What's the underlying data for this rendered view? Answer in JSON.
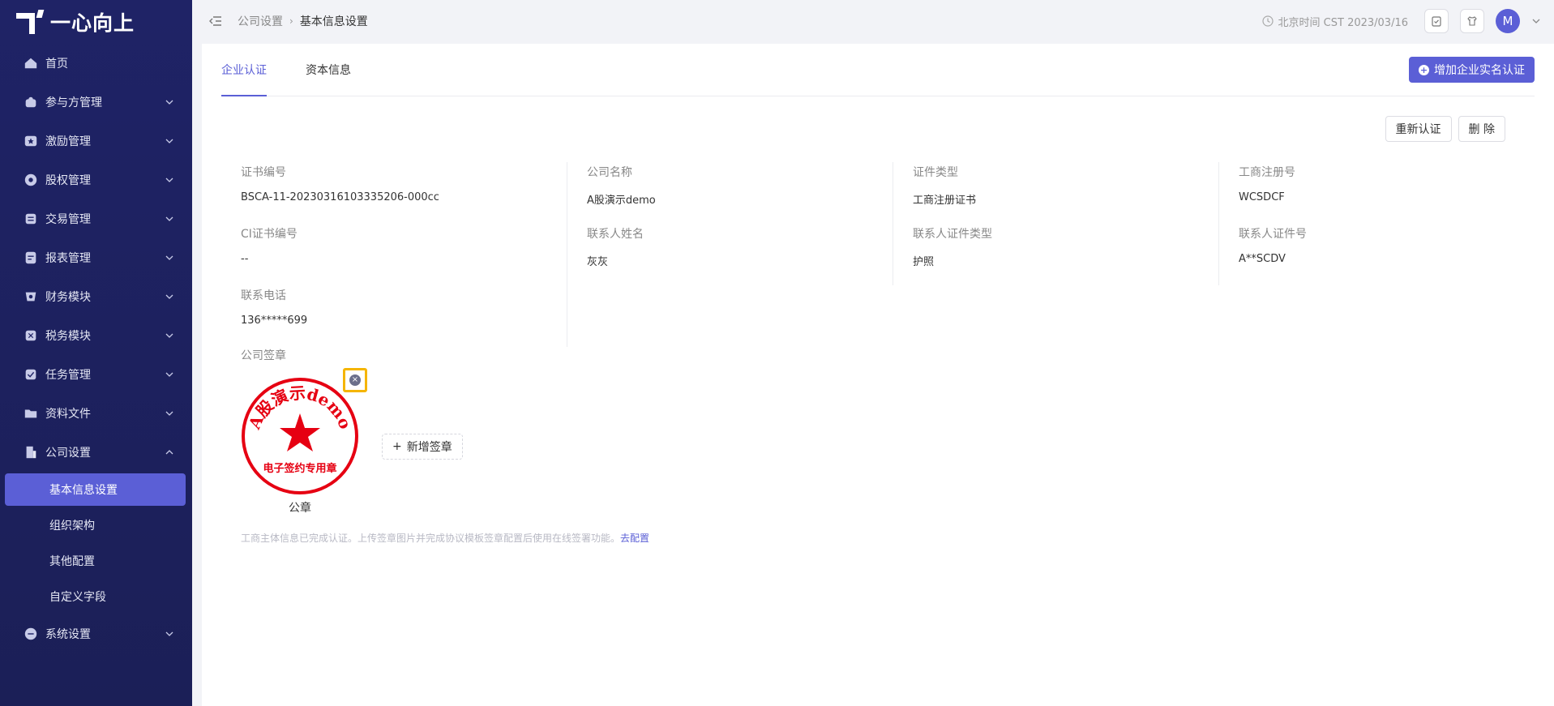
{
  "brand": {
    "name": "一心向上"
  },
  "sidebar": {
    "items": [
      {
        "label": "首页",
        "icon": "home-icon",
        "expandable": false
      },
      {
        "label": "参与方管理",
        "icon": "users-icon",
        "expandable": true
      },
      {
        "label": "激励管理",
        "icon": "star-icon",
        "expandable": true
      },
      {
        "label": "股权管理",
        "icon": "pie-icon",
        "expandable": true
      },
      {
        "label": "交易管理",
        "icon": "exchange-icon",
        "expandable": true
      },
      {
        "label": "报表管理",
        "icon": "report-icon",
        "expandable": true
      },
      {
        "label": "财务模块",
        "icon": "finance-icon",
        "expandable": true
      },
      {
        "label": "税务模块",
        "icon": "tax-icon",
        "expandable": true
      },
      {
        "label": "任务管理",
        "icon": "task-icon",
        "expandable": true
      },
      {
        "label": "资料文件",
        "icon": "folder-icon",
        "expandable": true
      },
      {
        "label": "公司设置",
        "icon": "building-icon",
        "expandable": true,
        "expanded": true
      },
      {
        "label": "系统设置",
        "icon": "settings-icon",
        "expandable": true
      }
    ],
    "company_sub": [
      "基本信息设置",
      "组织架构",
      "其他配置",
      "自定义字段"
    ]
  },
  "header": {
    "breadcrumb": [
      "公司设置",
      "基本信息设置"
    ],
    "time": "北京时间 CST 2023/03/16",
    "avatar": "M"
  },
  "tabs": [
    "企业认证",
    "资本信息"
  ],
  "primary_action": "增加企业实名认证",
  "actions": {
    "reauth": "重新认证",
    "delete": "删 除"
  },
  "info": [
    {
      "key": "证书编号",
      "value": "BSCA-11-20230316103335206-000cc"
    },
    {
      "key": "公司名称",
      "value": "A股演示demo"
    },
    {
      "key": "证件类型",
      "value": "工商注册证书"
    },
    {
      "key": "工商注册号",
      "value": "WCSDCF"
    },
    {
      "key": "CI证书编号",
      "value": "--"
    },
    {
      "key": "联系人姓名",
      "value": "灰灰"
    },
    {
      "key": "联系人证件类型",
      "value": "护照"
    },
    {
      "key": "联系人证件号",
      "value": "A**SCDV"
    },
    {
      "key": "联系电话",
      "value": "136*****699"
    }
  ],
  "seal": {
    "section_label": "公司签章",
    "stamp_top_text": "A股演示demo",
    "stamp_bottom_text": "电子签约专用章",
    "name": "公章",
    "color": "#e60012"
  },
  "add_seal": "新增签章",
  "note": {
    "text": "工商主体信息已完成认证。上传签章图片并完成协议模板签章配置后使用在线签署功能。",
    "link": "去配置"
  }
}
